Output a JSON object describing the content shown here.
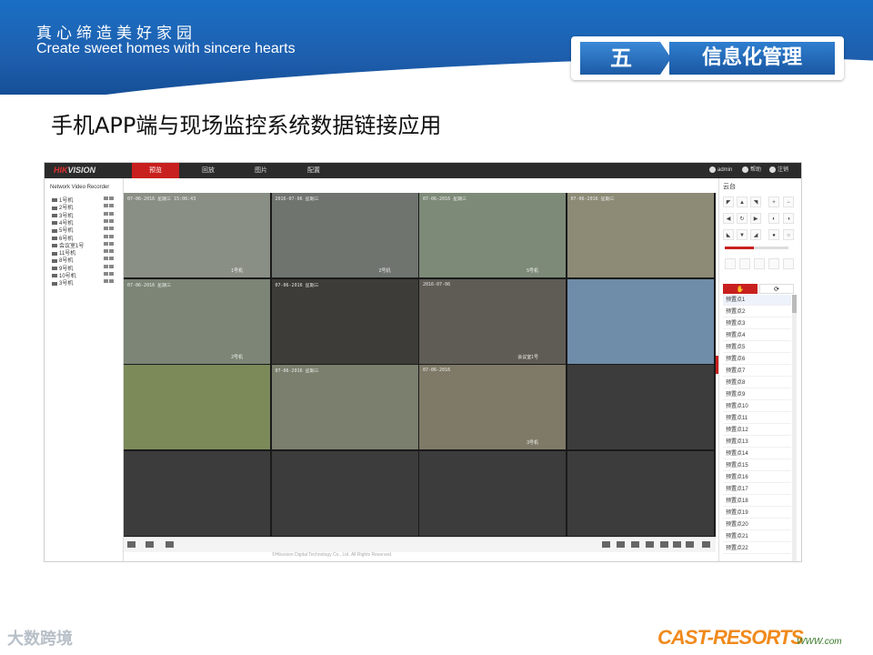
{
  "header": {
    "motto_cn": "真心缔造美好家园",
    "motto_en": "Create sweet homes with sincere hearts",
    "section_number": "五",
    "section_title": "信息化管理"
  },
  "page_title": "手机APP端与现场监控系统数据链接应用",
  "app": {
    "brand_red": "HIK",
    "brand_white": "VISION",
    "tabs": [
      {
        "label": "预览",
        "active": true
      },
      {
        "label": "回放",
        "active": false
      },
      {
        "label": "图片",
        "active": false
      },
      {
        "label": "配置",
        "active": false
      }
    ],
    "user": "admin",
    "help": "帮助",
    "logout": "注销",
    "device_root": "Network Video Recorder",
    "devices": [
      "1号机",
      "2号机",
      "3号机",
      "4号机",
      "5号机",
      "6号机",
      "会议室1号",
      "11号机",
      "8号机",
      "9号机",
      "10号机",
      "3号机"
    ],
    "tiles": [
      {
        "ts": "07-06-2016 星期三 15:06:43",
        "name": "1号机",
        "bg": "#8a8f86"
      },
      {
        "ts": "2016-07-06 星期三",
        "name": "2号机",
        "bg": "#6f746e"
      },
      {
        "ts": "07-06-2016 星期三",
        "name": "5号机",
        "bg": "#7d8a78"
      },
      {
        "ts": "07-06-2016 星期三",
        "name": "",
        "bg": "#8d8a76"
      },
      {
        "ts": "07-06-2016 星期三",
        "name": "2号机",
        "bg": "#7c8576"
      },
      {
        "ts": "07-06-2016 星期三",
        "name": "",
        "bg": "#3e3c38"
      },
      {
        "ts": "2016-07-06",
        "name": "会议室1号",
        "bg": "#5f5c55"
      },
      {
        "ts": "",
        "name": "",
        "bg": "#6f8ca8"
      },
      {
        "ts": "",
        "name": "",
        "bg": "#7c8a5a"
      },
      {
        "ts": "07-06-2016 星期三",
        "name": "",
        "bg": "#7a7f6e"
      },
      {
        "ts": "07-06-2016",
        "name": "3号机",
        "bg": "#7f7a68"
      },
      {
        "ts": "",
        "name": "",
        "bg": "#3c3c3c"
      }
    ],
    "footer": "©Hikvision Digital Technology Co., Ltd. All Rights Reserved.",
    "ptz_title": "云台",
    "ptz_buttons": [
      "◤",
      "▲",
      "◥",
      "◀",
      "↻",
      "▶",
      "◣",
      "▼",
      "◢"
    ],
    "preset_tabs": [
      "✋",
      "⟳"
    ],
    "presets": [
      "预置点1",
      "预置点2",
      "预置点3",
      "预置点4",
      "预置点5",
      "预置点6",
      "预置点7",
      "预置点8",
      "预置点9",
      "预置点10",
      "预置点11",
      "预置点12",
      "预置点13",
      "预置点14",
      "预置点15",
      "预置点16",
      "预置点17",
      "预置点18",
      "预置点19",
      "预置点20",
      "预置点21",
      "预置点22"
    ]
  },
  "watermarks": {
    "left": "大数跨境",
    "right": "CAST-RESORTS",
    "right_small": "WWW.com"
  }
}
